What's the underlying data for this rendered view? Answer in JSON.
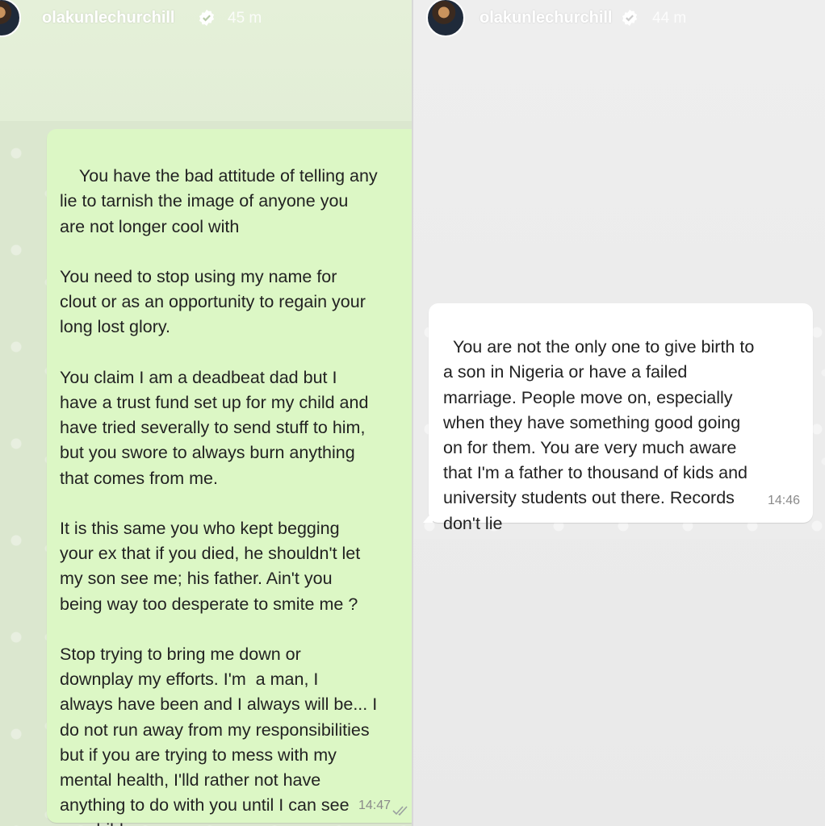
{
  "left_story": {
    "username": "olakunlechurchill",
    "time_ago": "45 m",
    "message": {
      "text": "You have the bad attitude of telling any\nlie to tarnish the image of anyone you\nare not longer cool with\n\nYou need to stop using my name for\nclout or as an opportunity to regain your\nlong lost glory.\n\nYou claim I am a deadbeat dad but I\nhave a trust fund set up for my child and\nhave tried severally to send stuff to him,\nbut you swore to always burn anything\nthat comes from me.\n\nIt is this same you who kept begging\nyour ex that if you died, he shouldn't let\nmy son see me; his father. Ain't you\nbeing way too desperate to smite me ?\n\nStop trying to bring me down or\ndownplay my efforts. I'm  a man, I\nalways have been and I always will be... I\ndo not run away from my responsibilities\nbut if you are trying to mess with my\nmental health, I'lld rather not have\nanything to do with you until I can see\nmy child.",
      "time": "14:47"
    }
  },
  "right_story": {
    "username": "olakunlechurchill",
    "time_ago": "44 m",
    "message": {
      "text": "You are not the only one to give birth to\na son in Nigeria or have a failed\nmarriage. People move on, especially\nwhen they have something good going\non for them. You are very much aware\nthat I'm a father to thousand of kids and\nuniversity students out there. Records\ndon't lie",
      "time": "14:46"
    }
  },
  "colors": {
    "sent_bubble": "#dcf7c5",
    "received_bubble": "#ffffff",
    "left_background": "#dbe9cf",
    "right_background": "#eeeeee"
  },
  "icons": [
    "verified-badge-icon",
    "read-receipt-icon",
    "avatar"
  ]
}
